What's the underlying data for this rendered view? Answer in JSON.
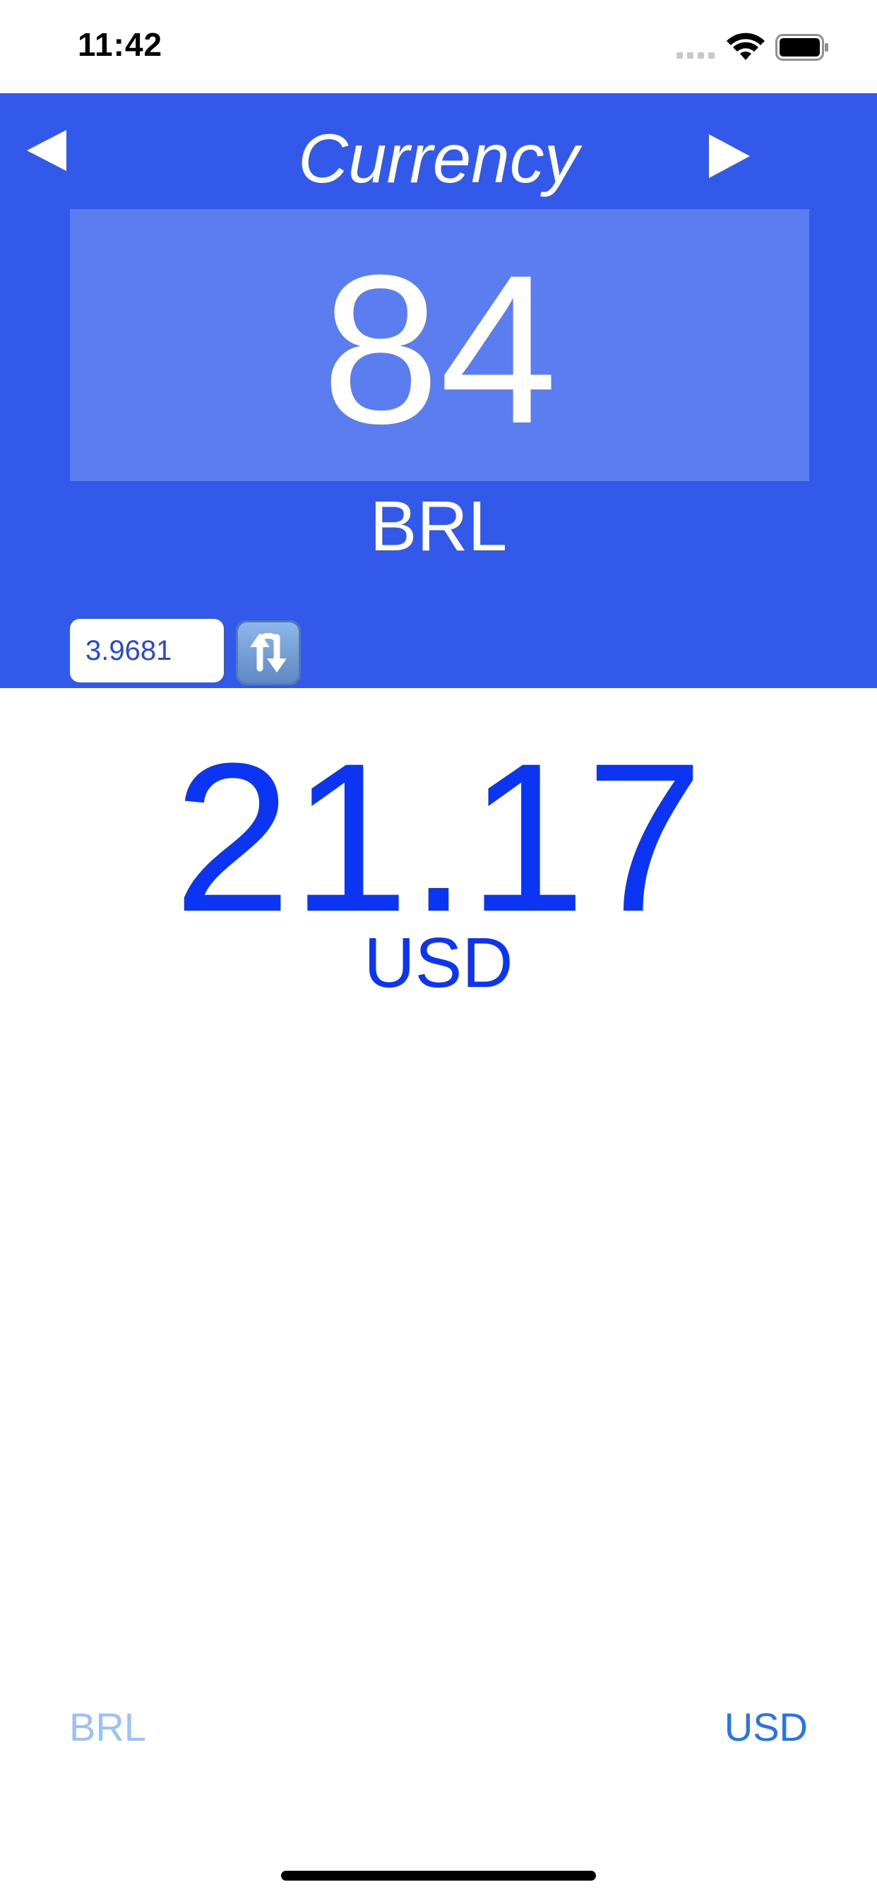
{
  "status_bar": {
    "time": "11:42"
  },
  "header": {
    "title": "Currency",
    "prev_icon": "triangle-left",
    "next_icon": "triangle-right"
  },
  "converter": {
    "amount": "84",
    "from_code": "BRL",
    "rate": "3.9681",
    "refresh_icon": "counterclockwise-arrows",
    "result": "21.17",
    "to_code": "USD"
  },
  "selectors": {
    "from_label": "BRL",
    "to_label": "USD"
  },
  "colors": {
    "header_bg": "#3359eb",
    "amount_box_bg": "#5c7def",
    "result_text": "#0b35f2",
    "from_selector": "#9bc2f3",
    "to_selector": "#2773e7"
  }
}
